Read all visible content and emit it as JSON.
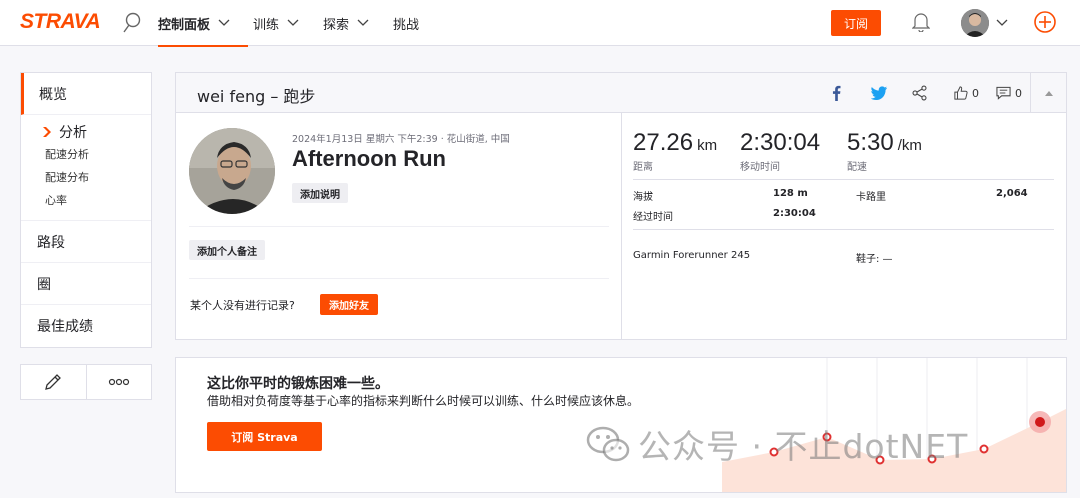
{
  "nav": {
    "logo": "STRAVA",
    "items": [
      {
        "label": "控制面板",
        "active": true
      },
      {
        "label": "训练"
      },
      {
        "label": "探索"
      },
      {
        "label": "挑战"
      }
    ],
    "subscribe_label": "订阅"
  },
  "sidebar": {
    "overview": "概览",
    "analysis": "分析",
    "analysis_items": [
      "配速分析",
      "配速分布",
      "心率"
    ],
    "segments": "路段",
    "laps": "圈",
    "best_efforts": "最佳成绩"
  },
  "activity": {
    "header_title": "wei feng – 跑步",
    "kudos_count": "0",
    "comment_count": "0",
    "meta": "2024年1月13日 星期六 下午2:39 · 花山街道, 中国",
    "name": "Afternoon Run",
    "add_description": "添加说明",
    "add_private_note": "添加个人备注",
    "kudos_text": "某个人没有进行记录?",
    "add_friend": "添加好友",
    "stats": [
      {
        "value": "27.26",
        "unit": "km",
        "label": "距离"
      },
      {
        "value": "2:30:04",
        "unit": "",
        "label": "移动时间"
      },
      {
        "value": "5:30",
        "unit": "/km",
        "label": "配速"
      }
    ],
    "details": {
      "elevation_label": "海拔",
      "elevation_value": "128 m",
      "calories_label": "卡路里",
      "calories_value": "2,064",
      "elapsed_label": "经过时间",
      "elapsed_value": "2:30:04",
      "device": "Garmin Forerunner 245",
      "shoes": "鞋子: —"
    }
  },
  "upsell": {
    "title": "这比你平时的锻炼困难一些。",
    "subtitle": "借助相对负荷度等基于心率的指标来判断什么时候可以训练、什么时候应该休息。",
    "button": "订阅 Strava"
  },
  "watermark": "公众号 · 不止dotNET",
  "colors": {
    "accent": "#fc4c02",
    "text": "#242428",
    "muted": "#6d6d78",
    "border": "#dfdfe8"
  }
}
